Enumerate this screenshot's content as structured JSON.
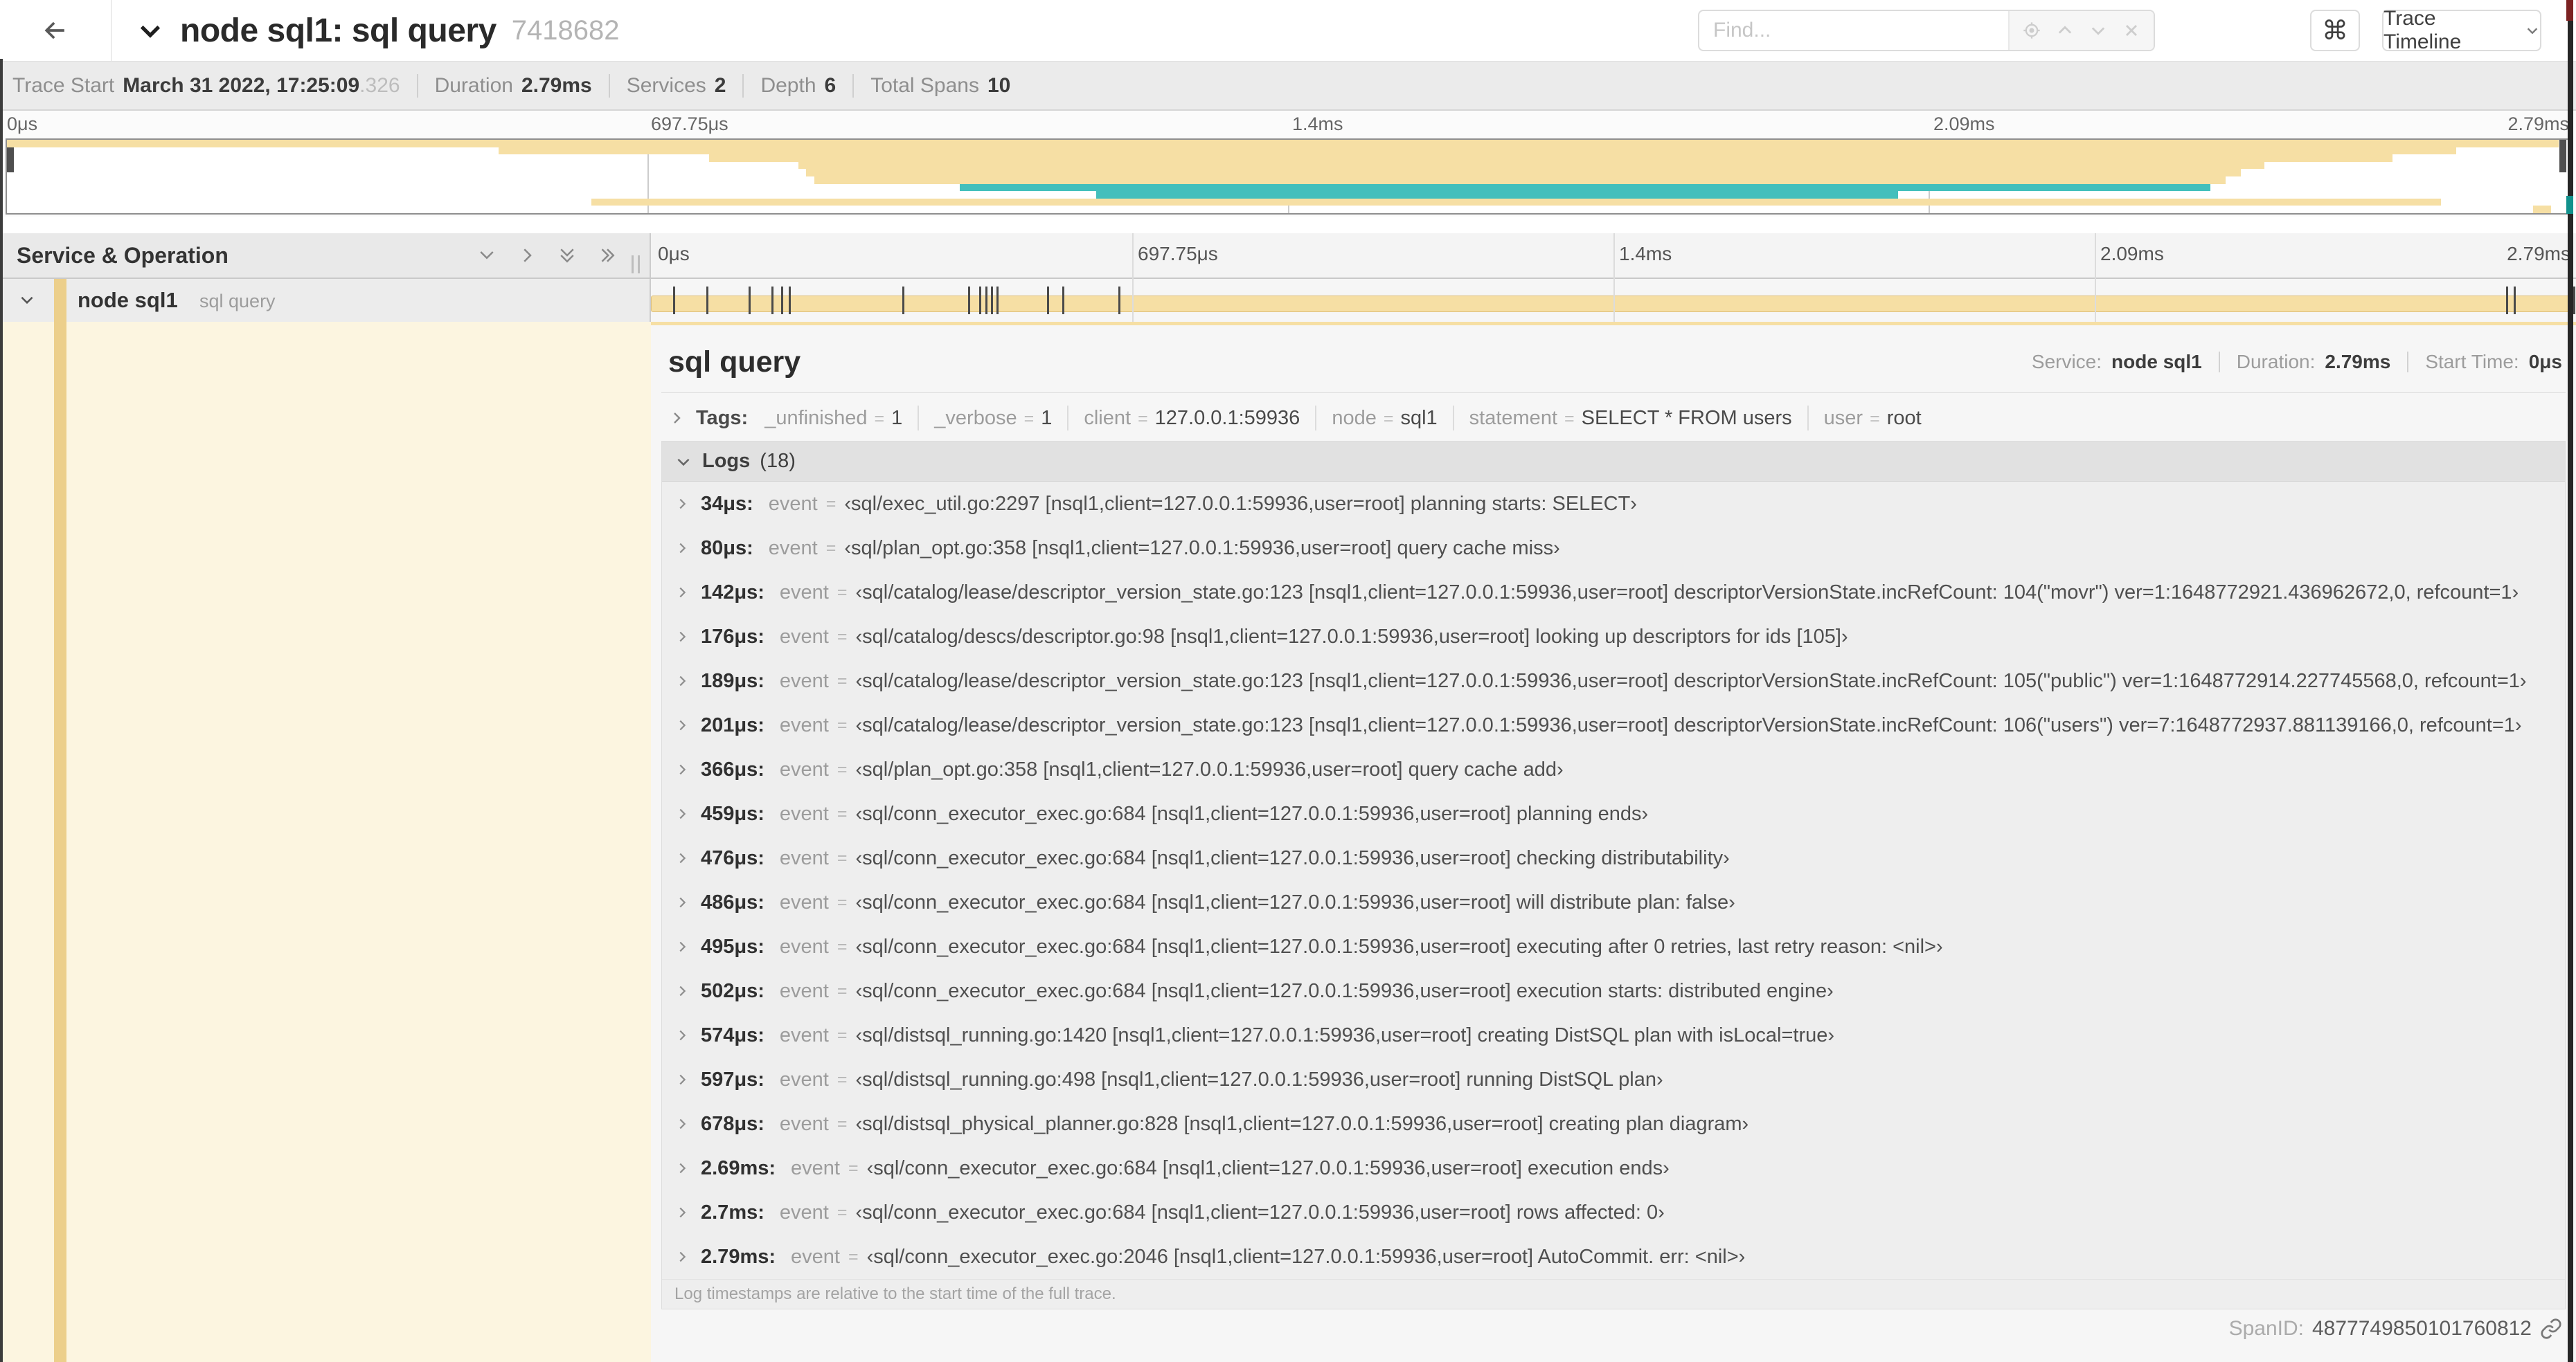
{
  "colors": {
    "tan": "#f6dfa4",
    "tan_strong": "#eccf8b",
    "teal": "#43bfbc",
    "cream": "#fcf5e0"
  },
  "header": {
    "title": "node sql1: sql query",
    "trace_id": "7418682",
    "find_placeholder": "Find...",
    "keyboard_shortcut": "⌘",
    "view_selector": "Trace Timeline"
  },
  "trace_meta": {
    "items": [
      {
        "label": "Trace Start",
        "value": "March 31 2022, 17:25:09",
        "suffix": ".326"
      },
      {
        "label": "Duration",
        "value": "2.79ms"
      },
      {
        "label": "Services",
        "value": "2"
      },
      {
        "label": "Depth",
        "value": "6"
      },
      {
        "label": "Total Spans",
        "value": "10"
      }
    ]
  },
  "minimap": {
    "tick_labels": [
      "0μs",
      "697.75μs",
      "1.4ms",
      "2.09ms",
      "2.79ms"
    ],
    "tick_pcts": [
      0,
      25,
      50,
      75,
      100
    ],
    "grid_pcts": [
      25,
      50,
      75
    ],
    "spans": [
      {
        "start": 0,
        "end": 99.6,
        "color": "tan"
      },
      {
        "start": 19.2,
        "end": 95.6,
        "color": "tan"
      },
      {
        "start": 27.4,
        "end": 93.1,
        "color": "tan"
      },
      {
        "start": 30.9,
        "end": 88.1,
        "color": "tan"
      },
      {
        "start": 31.2,
        "end": 87.2,
        "color": "tan"
      },
      {
        "start": 31.5,
        "end": 86.6,
        "color": "tan"
      },
      {
        "start": 37.2,
        "end": 86.0,
        "color": "teal"
      },
      {
        "start": 42.5,
        "end": 73.8,
        "color": "teal"
      },
      {
        "start": 22.8,
        "end": 95.0,
        "color": "tan"
      },
      {
        "start": 98.6,
        "end": 99.3,
        "color": "tan"
      }
    ]
  },
  "timeline": {
    "left_header": "Service & Operation",
    "tick_labels": [
      "0μs",
      "697.75μs",
      "1.4ms",
      "2.09ms",
      "2.79ms"
    ],
    "tick_pcts": [
      0,
      25,
      50,
      75,
      100
    ],
    "grid_pcts": [
      25,
      50,
      75
    ],
    "log_mark_pcts": [
      1.2,
      2.9,
      5.1,
      6.3,
      6.8,
      7.2,
      13.1,
      16.5,
      17.1,
      17.4,
      17.7,
      18.0,
      20.6,
      21.4,
      24.3,
      96.4,
      96.8,
      99.9
    ]
  },
  "span_row": {
    "service": "node sql1",
    "operation": "sql query"
  },
  "detail": {
    "title": "sql query",
    "service_label": "Service:",
    "service": "node sql1",
    "duration_label": "Duration:",
    "duration": "2.79ms",
    "start_time_label": "Start Time:",
    "start_time": "0μs",
    "tags_label": "Tags:",
    "tags": [
      {
        "key": "_unfinished",
        "value": "1"
      },
      {
        "key": "_verbose",
        "value": "1"
      },
      {
        "key": "client",
        "value": "127.0.0.1:59936"
      },
      {
        "key": "node",
        "value": "sql1"
      },
      {
        "key": "statement",
        "value": "SELECT * FROM users"
      },
      {
        "key": "user",
        "value": "root"
      }
    ],
    "logs_label": "Logs",
    "logs_count": "(18)",
    "log_field_key": "event",
    "equals": "=",
    "logs": [
      {
        "time": "34μs:",
        "value": "‹sql/exec_util.go:2297 [nsql1,client=127.0.0.1:59936,user=root] planning starts: SELECT›"
      },
      {
        "time": "80μs:",
        "value": "‹sql/plan_opt.go:358 [nsql1,client=127.0.0.1:59936,user=root] query cache miss›"
      },
      {
        "time": "142μs:",
        "value": "‹sql/catalog/lease/descriptor_version_state.go:123 [nsql1,client=127.0.0.1:59936,user=root] descriptorVersionState.incRefCount: 104(\"movr\") ver=1:1648772921.436962672,0, refcount=1›"
      },
      {
        "time": "176μs:",
        "value": "‹sql/catalog/descs/descriptor.go:98 [nsql1,client=127.0.0.1:59936,user=root] looking up descriptors for ids [105]›"
      },
      {
        "time": "189μs:",
        "value": "‹sql/catalog/lease/descriptor_version_state.go:123 [nsql1,client=127.0.0.1:59936,user=root] descriptorVersionState.incRefCount: 105(\"public\") ver=1:1648772914.227745568,0, refcount=1›"
      },
      {
        "time": "201μs:",
        "value": "‹sql/catalog/lease/descriptor_version_state.go:123 [nsql1,client=127.0.0.1:59936,user=root] descriptorVersionState.incRefCount: 106(\"users\") ver=7:1648772937.881139166,0, refcount=1›"
      },
      {
        "time": "366μs:",
        "value": "‹sql/plan_opt.go:358 [nsql1,client=127.0.0.1:59936,user=root] query cache add›"
      },
      {
        "time": "459μs:",
        "value": "‹sql/conn_executor_exec.go:684 [nsql1,client=127.0.0.1:59936,user=root] planning ends›"
      },
      {
        "time": "476μs:",
        "value": "‹sql/conn_executor_exec.go:684 [nsql1,client=127.0.0.1:59936,user=root] checking distributability›"
      },
      {
        "time": "486μs:",
        "value": "‹sql/conn_executor_exec.go:684 [nsql1,client=127.0.0.1:59936,user=root] will distribute plan: false›"
      },
      {
        "time": "495μs:",
        "value": "‹sql/conn_executor_exec.go:684 [nsql1,client=127.0.0.1:59936,user=root] executing after 0 retries, last retry reason: <nil>›"
      },
      {
        "time": "502μs:",
        "value": "‹sql/conn_executor_exec.go:684 [nsql1,client=127.0.0.1:59936,user=root] execution starts: distributed engine›"
      },
      {
        "time": "574μs:",
        "value": "‹sql/distsql_running.go:1420 [nsql1,client=127.0.0.1:59936,user=root] creating DistSQL plan with isLocal=true›"
      },
      {
        "time": "597μs:",
        "value": "‹sql/distsql_running.go:498 [nsql1,client=127.0.0.1:59936,user=root] running DistSQL plan›"
      },
      {
        "time": "678μs:",
        "value": "‹sql/distsql_physical_planner.go:828 [nsql1,client=127.0.0.1:59936,user=root] creating plan diagram›"
      },
      {
        "time": "2.69ms:",
        "value": "‹sql/conn_executor_exec.go:684 [nsql1,client=127.0.0.1:59936,user=root] execution ends›"
      },
      {
        "time": "2.7ms:",
        "value": "‹sql/conn_executor_exec.go:684 [nsql1,client=127.0.0.1:59936,user=root] rows affected: 0›"
      },
      {
        "time": "2.79ms:",
        "value": "‹sql/conn_executor_exec.go:2046 [nsql1,client=127.0.0.1:59936,user=root] AutoCommit. err: <nil>›"
      }
    ],
    "logs_note": "Log timestamps are relative to the start time of the full trace.",
    "span_id_label": "SpanID:",
    "span_id": "4877749850101760812"
  }
}
